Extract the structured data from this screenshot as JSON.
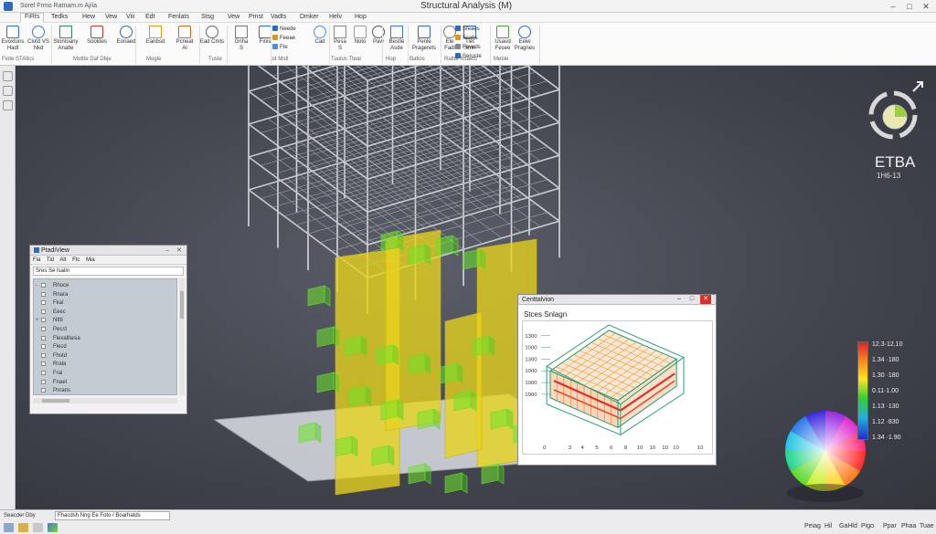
{
  "window": {
    "doc_title": "Sorel  Frmo Ratnam.m Aj/ia",
    "title": "Structural Analysis (M)",
    "controls": [
      "–",
      "□",
      "✕"
    ]
  },
  "menu": {
    "items": [
      "FiRts",
      "Tedks",
      "Hew",
      "Vew",
      "Viii",
      "Edt",
      "Fenlats",
      "Stsg",
      "Vew",
      "Pmst",
      "Vadts",
      "Dmker",
      "Helv",
      "Hop"
    ],
    "active_index": 0
  },
  "ribbon": {
    "buttons": [
      {
        "line1": "Evoxtuns",
        "line2": "Hadl",
        "icon": "pencil-icon"
      },
      {
        "line1": "Clotd VS",
        "line2": "Nkd",
        "icon": "copy-icon"
      },
      {
        "line1": "Stontoany",
        "line2": "Anatle",
        "icon": "analyze-icon"
      },
      {
        "line1": "Sooldes",
        "line2": "",
        "icon": "wrench-icon"
      },
      {
        "line1": "Eonaed",
        "line2": "",
        "icon": "target-icon"
      },
      {
        "line1": "Eanbsd",
        "line2": "",
        "icon": "chart-icon"
      },
      {
        "line1": "Pcneat",
        "line2": "Al",
        "icon": "edit-icon"
      },
      {
        "line1": "Ead Cmts",
        "line2": "",
        "icon": "list-icon"
      },
      {
        "line1": "Gnha",
        "line2": "S",
        "icon": "search-icon"
      },
      {
        "line1": "Finis",
        "line2": "",
        "icon": "zoom-icon"
      },
      {
        "line1": "Cad",
        "line2": "",
        "icon": "cube-icon"
      },
      {
        "line1": "Pesa",
        "line2": "S",
        "icon": "eye-icon"
      },
      {
        "line1": "Noto",
        "line2": "",
        "icon": "sphere-icon"
      },
      {
        "line1": "Paw",
        "line2": "",
        "icon": "settings-icon"
      },
      {
        "line1": "Bestle",
        "line2": "Asde",
        "icon": "grid-icon"
      },
      {
        "line1": "Penle",
        "line2": "Pragerets",
        "icon": "line-icon"
      },
      {
        "line1": "Ete",
        "line2": "Fadl",
        "icon": "tools-icon"
      },
      {
        "line1": "Tiet",
        "line2": "Smn",
        "icon": "table-icon"
      },
      {
        "line1": "Usaud",
        "line2": "Fesee",
        "icon": "layers-icon"
      },
      {
        "line1": "Eeiw",
        "line2": "Pragnes",
        "icon": "image-icon"
      }
    ],
    "small_items": [
      "Neede",
      "Feeae",
      "Fte",
      "Sfeaes",
      "Ssahs",
      "Feveds",
      "Seruste"
    ],
    "groups": [
      "Fiote STAtlcs",
      "Mottte Daf Dbje",
      "Mogle",
      "Tuste",
      "tot Mstl",
      "Tuulus Ttear",
      "Hop",
      "Batlos",
      "Raltte Rsaets",
      "Meble"
    ]
  },
  "brand": {
    "name": "ETBA",
    "sub": "1H6-13"
  },
  "model_tree": {
    "title": "PtadiView",
    "menu": [
      "Fia",
      "Tid",
      "Alt",
      "Ftc",
      "Mia"
    ],
    "search": "Sres Se Isalin",
    "rows": [
      {
        "label": "Rhoce",
        "expander": "-"
      },
      {
        "label": "Rnara",
        "expander": ""
      },
      {
        "label": "Fkal",
        "expander": ""
      },
      {
        "label": "Eeec",
        "expander": ""
      },
      {
        "label": "Ntttl",
        "expander": "+"
      },
      {
        "label": "Pecct",
        "expander": ""
      },
      {
        "label": "Flexalllasia",
        "expander": ""
      },
      {
        "label": "Flecd",
        "expander": ""
      },
      {
        "label": "Fhstd",
        "expander": ""
      },
      {
        "label": "Rrala",
        "expander": ""
      },
      {
        "label": "Frai",
        "expander": ""
      },
      {
        "label": "Fnael",
        "expander": ""
      },
      {
        "label": "Pnrans",
        "expander": ""
      }
    ]
  },
  "contour": {
    "title": "Centtalvion",
    "label": "Stces Snlagn",
    "y_ticks": [
      "1300",
      "1000",
      "1300",
      "1000",
      "1000",
      "1900"
    ],
    "x_ticks": [
      "0",
      "3",
      "4",
      "5",
      "6",
      "8",
      "10",
      "10",
      "10",
      "10"
    ],
    "x_end": "10"
  },
  "legend": {
    "ticks": [
      "12.3·12.10",
      "1.34 ·180",
      "1.30 ·180",
      "0.11·1.00",
      "1.13 ·130",
      "1.12 ·830",
      "1.34 ·1.90"
    ]
  },
  "status": {
    "left": "Seacder Dby",
    "field": "Fhacdsh Nng Ee Foto / Boarhatds",
    "icons": [
      "window-icon",
      "folder-icon",
      "document-icon",
      "app-icon"
    ],
    "right": [
      "Peiag",
      "Hil",
      "GaHld",
      "Pigo",
      "Ppar",
      "Phaa",
      "Tuae"
    ]
  }
}
